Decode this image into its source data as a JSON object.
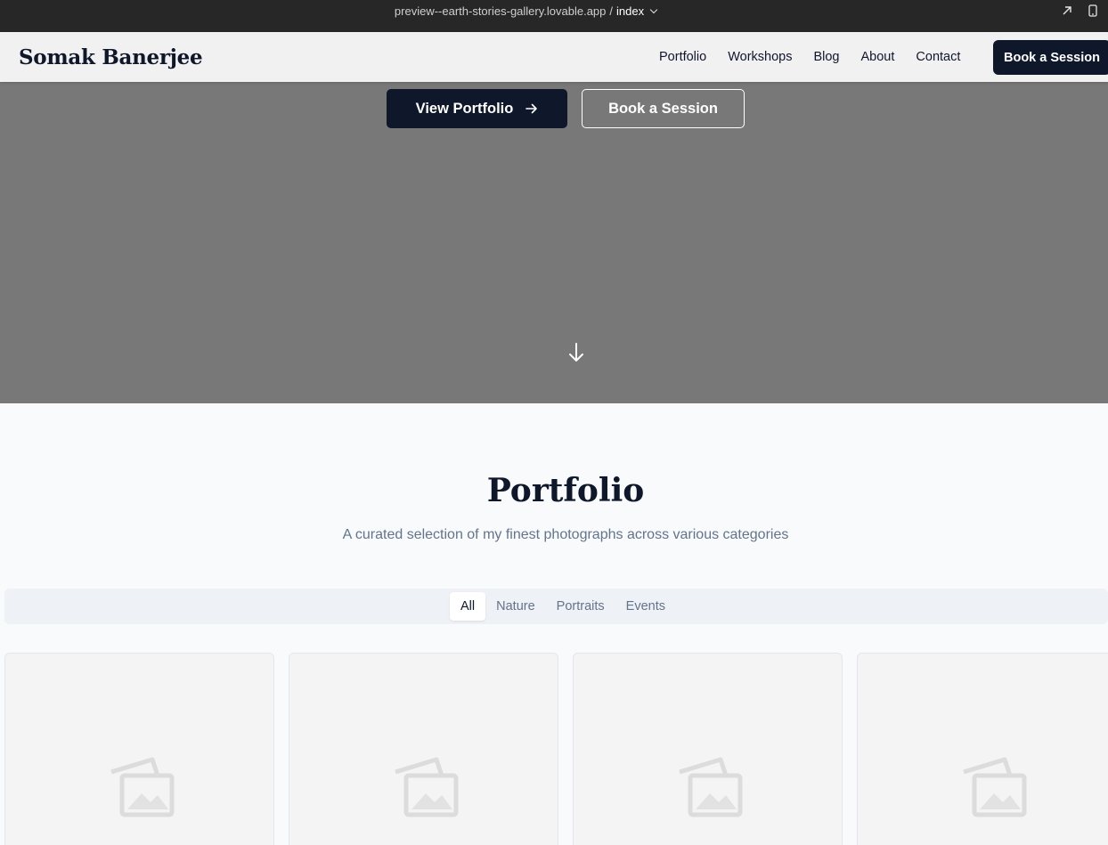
{
  "preview_bar": {
    "host": "preview--earth-stories-gallery.lovable.app",
    "separator": "/",
    "page": "index",
    "open_icon": "external-link-icon",
    "device_icon": "mobile-device-icon"
  },
  "navbar": {
    "logo": "Somak Banerjee",
    "links": [
      "Portfolio",
      "Workshops",
      "Blog",
      "About",
      "Contact"
    ],
    "cta": "Book a Session"
  },
  "hero": {
    "primary_button": "View Portfolio",
    "primary_icon": "arrow-right-icon",
    "secondary_button": "Book a Session",
    "scroll_icon": "arrow-down-icon"
  },
  "portfolio": {
    "title": "Portfolio",
    "subtitle": "A curated selection of my finest photographs across various categories",
    "filters": [
      "All",
      "Nature",
      "Portraits",
      "Events"
    ],
    "active_filter": "All",
    "cards": [
      {
        "icon": "image-placeholder-icon"
      },
      {
        "icon": "image-placeholder-icon"
      },
      {
        "icon": "image-placeholder-icon"
      },
      {
        "icon": "image-placeholder-icon"
      }
    ]
  },
  "colors": {
    "brand_dark": "#0f172a",
    "hero_bg": "#787878",
    "muted_text": "#64748b",
    "page_bg": "#f8fafc"
  }
}
